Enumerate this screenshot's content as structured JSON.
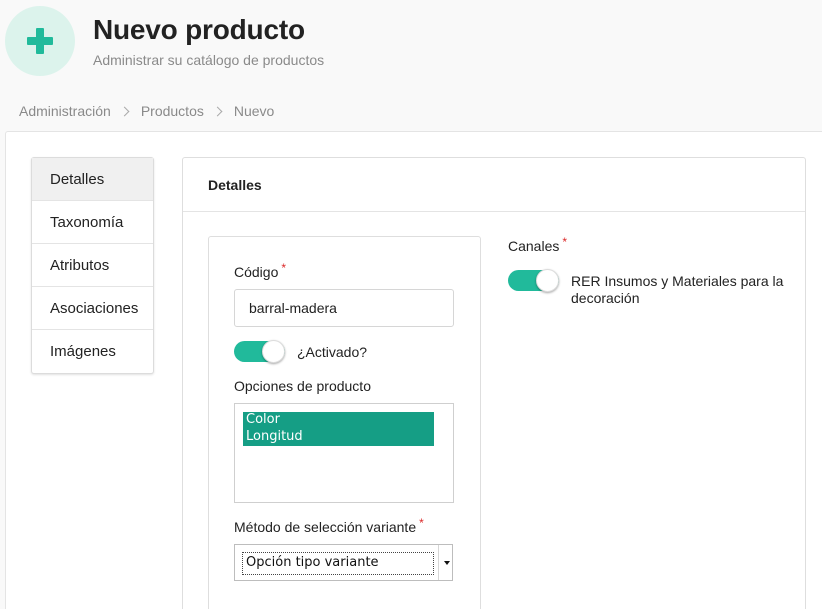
{
  "header": {
    "icon": "plus-icon",
    "title": "Nuevo producto",
    "subtitle": "Administrar su catálogo de productos"
  },
  "breadcrumb": {
    "items": [
      "Administración",
      "Productos"
    ],
    "current": "Nuevo"
  },
  "sidebar": {
    "items": [
      {
        "label": "Detalles",
        "active": true
      },
      {
        "label": "Taxonomía",
        "active": false
      },
      {
        "label": "Atributos",
        "active": false
      },
      {
        "label": "Asociaciones",
        "active": false
      },
      {
        "label": "Imágenes",
        "active": false
      }
    ]
  },
  "card": {
    "title": "Detalles"
  },
  "form": {
    "code_label": "Código",
    "code_value": "barral-madera",
    "required_mark": "*",
    "enabled_label": "¿Activado?",
    "enabled": true,
    "options_label": "Opciones de producto",
    "options": [
      "Color",
      "Longitud"
    ],
    "variant_method_label": "Método de selección variante",
    "variant_method_value": "Opción tipo variante",
    "channels_label": "Canales",
    "channel_label": "RER Insumos y Materiales para la decoración",
    "channel_enabled": true
  },
  "colors": {
    "accent": "#21ba9b",
    "option_highlight": "#159e85",
    "required": "#db2828"
  }
}
